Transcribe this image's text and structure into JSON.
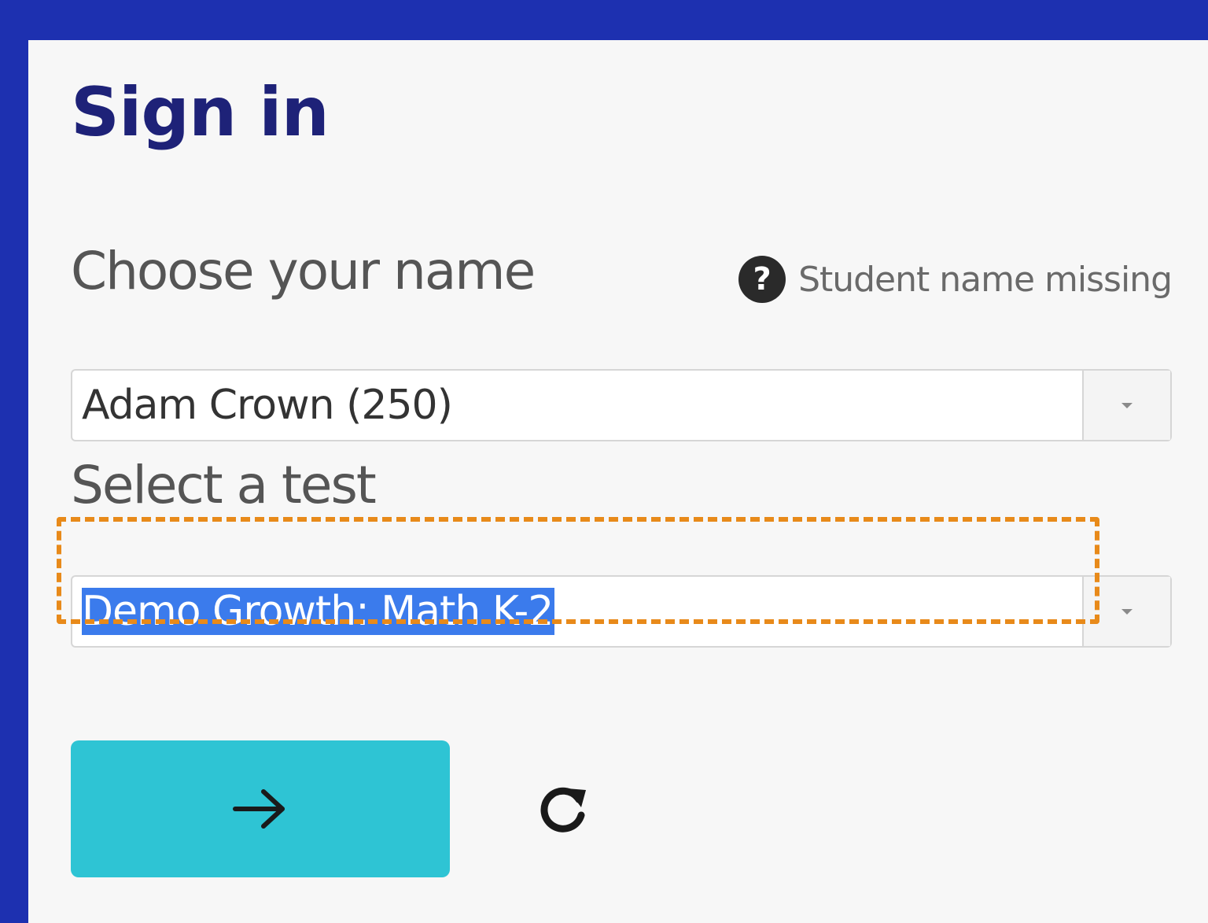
{
  "header": {
    "title": "Sign in"
  },
  "name_field": {
    "label": "Choose your name",
    "help_link": "Student name missing",
    "help_icon": "question-circle-icon",
    "selected": "Adam Crown (250)"
  },
  "test_field": {
    "label": "Select a test",
    "selected": "Demo Growth: Math K-2"
  },
  "actions": {
    "next_icon": "arrow-right-icon",
    "refresh_icon": "refresh-icon"
  },
  "colors": {
    "frame": "#1d30b0",
    "title": "#1e2278",
    "primary_button": "#2ec4d4",
    "focus_ring": "#e88a1a",
    "selection": "#3b7bec"
  }
}
